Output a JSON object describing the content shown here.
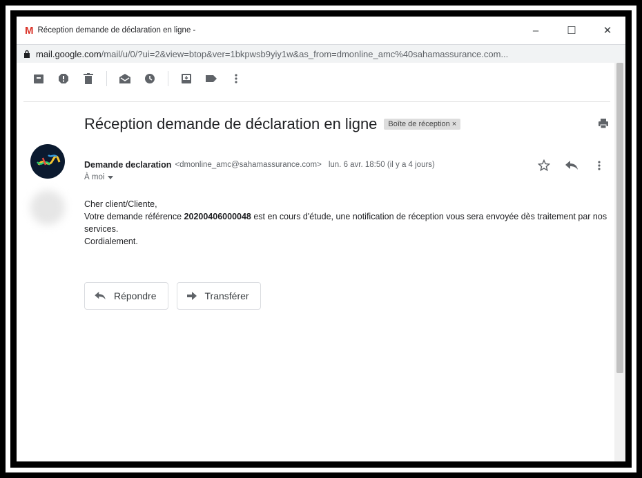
{
  "window": {
    "title": "Réception demande de déclaration en ligne -",
    "minimize_glyph": "–",
    "maximize_glyph": "☐",
    "close_glyph": "✕",
    "url_host": "mail.google.com",
    "url_path": "/mail/u/0/?ui=2&view=btop&ver=1bkpwsb9yiy1w&as_from=dmonline_amc%40sahamassurance.com..."
  },
  "toolbar": {
    "icons": [
      "archive-icon",
      "report-spam-icon",
      "delete-icon",
      "mark-unread-icon",
      "snooze-icon",
      "move-to-icon",
      "labels-icon",
      "more-vert-icon"
    ]
  },
  "email": {
    "subject": "Réception demande de déclaration en ligne",
    "label_chip": "Boîte de réception ×",
    "sender_name": "Demande declaration",
    "sender_email": "<dmonline_amc@sahamassurance.com>",
    "date": "lun. 6 avr. 18:50 (il y a 4 jours)",
    "to": "À moi",
    "greeting": "Cher client/Cliente,",
    "line1_pre": "Votre demande référence ",
    "reference": "20200406000048",
    "line1_post": " est en cours d'étude, une notification de réception vous sera envoyée dès traitement par nos services.",
    "closing": "Cordialement."
  },
  "buttons": {
    "reply_label": "Répondre",
    "forward_label": "Transférer"
  },
  "colors": {
    "gmail_red": "#d93025",
    "icon_grey": "#5f6368"
  }
}
